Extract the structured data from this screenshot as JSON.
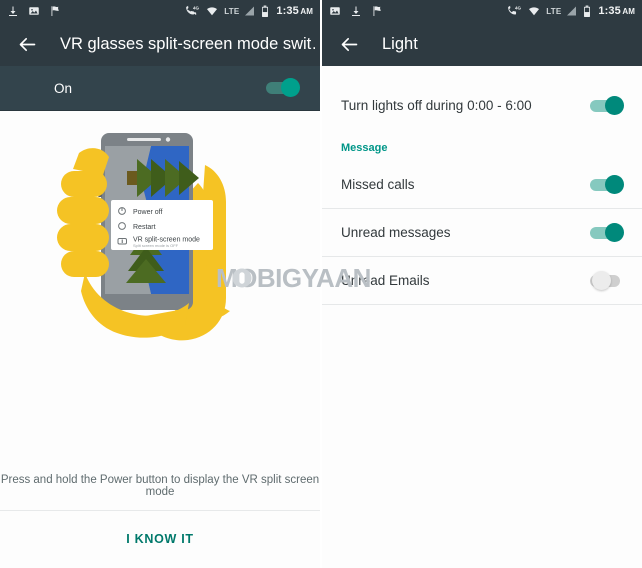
{
  "left": {
    "statusbar": {
      "time": "1:35",
      "ampm": "AM",
      "network_label": "LTE",
      "data_badge": "4G",
      "icons": [
        "download-icon",
        "image-icon",
        "flag-icon",
        "call-icon",
        "wifi-icon",
        "signal-icon",
        "battery-icon"
      ]
    },
    "appbar": {
      "back": "back-arrow-icon",
      "title": "VR glasses split-screen mode swit…"
    },
    "master": {
      "label": "On",
      "state": "on"
    },
    "illustration": {
      "menu_items": [
        {
          "label": "Power off",
          "icon": "power-icon",
          "sub": ""
        },
        {
          "label": "Restart",
          "icon": "restart-icon",
          "sub": ""
        },
        {
          "label": "VR split-screen mode",
          "icon": "vr-icon",
          "sub": "Split screen mode is OFF"
        }
      ]
    },
    "hint": "Press and hold the Power button to display the VR split screen mode",
    "action_button": "I KNOW IT"
  },
  "right": {
    "statusbar": {
      "time": "1:35",
      "ampm": "AM",
      "network_label": "LTE",
      "data_badge": "4G",
      "icons": [
        "image-icon",
        "download-icon",
        "flag-icon",
        "call-icon",
        "wifi-icon",
        "signal-icon",
        "battery-icon"
      ]
    },
    "appbar": {
      "back": "back-arrow-icon",
      "title": "Light"
    },
    "rows": [
      {
        "label": "Turn lights off during 0:00 - 6:00",
        "state": "on"
      },
      {
        "label": "Missed calls",
        "state": "on"
      },
      {
        "label": "Unread messages",
        "state": "on"
      },
      {
        "label": "Unread Emails",
        "state": "off"
      }
    ],
    "section_header": "Message"
  },
  "watermark": {
    "text": "MOBIGYAAN"
  },
  "colors": {
    "appbar": "#2e3a41",
    "master_row": "#33444c",
    "accent": "#009688",
    "switch_on": "#00897b",
    "switch_off": "#cfcfcf",
    "hand": "#f5c324",
    "body": "#fdfdfd"
  }
}
